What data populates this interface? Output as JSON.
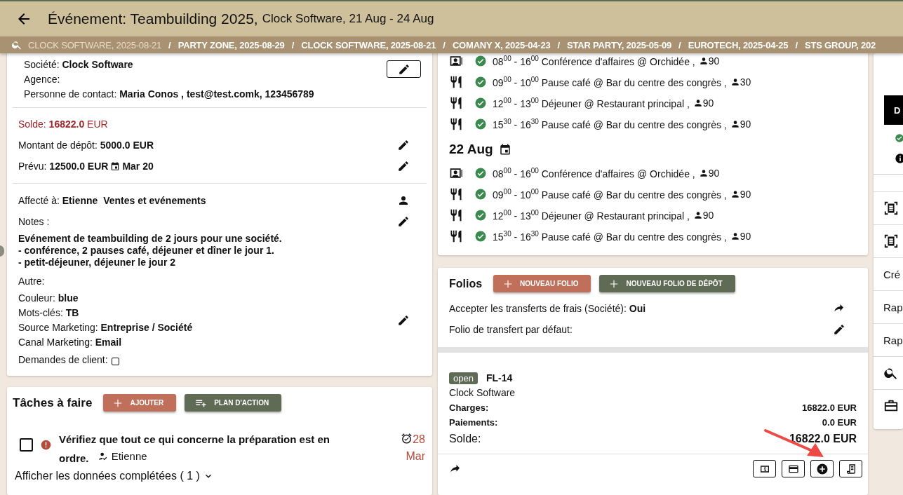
{
  "header": {
    "title": "Événement: Teambuilding 2025,",
    "subtitle": "Clock Software, 21 Aug - 24 Aug"
  },
  "breadcrumb_separator": "/",
  "breadcrumbs": [
    {
      "label": "CLOCK SOFTWARE, 2025-08-21",
      "selected": true
    },
    {
      "label": "PARTY ZONE, 2025-08-29",
      "selected": false
    },
    {
      "label": "CLOCK SOFTWARE, 2025-08-21",
      "selected": false
    },
    {
      "label": "COMANY X, 2025-04-23",
      "selected": false
    },
    {
      "label": "STAR PARTY, 2025-05-09",
      "selected": false
    },
    {
      "label": "EUROTECH, 2025-04-25",
      "selected": false
    },
    {
      "label": "STS GROUP, 202",
      "selected": false
    }
  ],
  "details": {
    "company_lines": [
      {
        "label": "Société:",
        "value": "Clock Software"
      },
      {
        "label": "Agence:"
      },
      {
        "label": "Personne de contact:",
        "value": "Maria Conos , test@test.comk, 123456789"
      }
    ],
    "balance": {
      "label": "Solde:",
      "value": "16822.0",
      "unit": "EUR"
    },
    "deposit": {
      "label": "Montant de dépôt:",
      "value": "5000.0 EUR"
    },
    "planned": {
      "label": "Prévu:",
      "value": "12500.0 EUR",
      "date": "Mar 20"
    },
    "assigned": {
      "label": "Affecté à:",
      "value": "Etienne  Ventes et evénements"
    },
    "notes": {
      "label": "Notes :",
      "lines": [
        "Evénement de teambuilding de 2 jours pour une société.",
        "- conférence, 2 pauses café, déjeuner et dîner le jour 1.",
        "- petit-déjeuner, déjeuner le jour 2"
      ]
    },
    "other_label": "Autre:",
    "other": [
      {
        "label": "Couleur:",
        "value": "blue"
      },
      {
        "label": "Mots-clés:",
        "value": "TB"
      },
      {
        "label": "Source Marketing:",
        "value": "Entreprise / Société"
      },
      {
        "label": "Canal Marketing:",
        "value": "Email"
      }
    ],
    "client_requests": {
      "label": "Demandes de client:",
      "checked": false
    }
  },
  "tasks": {
    "title": "Tâches à faire",
    "buttons": [
      {
        "label": "AJOUTER",
        "kind": "add"
      },
      {
        "label": "PLAN D'ACTION",
        "kind": "plan"
      }
    ],
    "items": [
      {
        "text": "Vérifiez que tout ce qui concerne la préparation est en ordre.",
        "assignee": "Etienne",
        "due_day": "28",
        "due_month": "Mar",
        "checked": false
      }
    ],
    "show_completed": "Afficher les données complétées ( 1 )"
  },
  "agenda": {
    "groups": [
      {
        "items": [
          {
            "kind": "meeting",
            "done": true,
            "time": "08$^{00}$ - 16$^{00}$",
            "text": "Conférence d'affaires @ Orchidée ,",
            "guests": "90"
          },
          {
            "kind": "meal",
            "done": true,
            "time": "09$^{00}$ - 10$^{00}$",
            "text": "Pause café @ Bar du centre des congrès ,",
            "guests": "30"
          },
          {
            "kind": "meal",
            "done": true,
            "time": "12$^{00}$ - 13$^{00}$",
            "text": "Déjeuner @ Restaurant principal ,",
            "guests": "90"
          },
          {
            "kind": "meal",
            "done": true,
            "time": "15$^{30}$ - 16$^{30}$",
            "text": "Pause café @ Bar du centre des congrès ,",
            "guests": "90"
          }
        ]
      },
      {
        "date": "22 Aug",
        "items": [
          {
            "kind": "meeting",
            "done": true,
            "time": "08$^{00}$ - 16$^{00}$",
            "text": "Conférence d'affaires @ Orchidée ,",
            "guests": "90"
          },
          {
            "kind": "meal",
            "done": true,
            "time": "09$^{00}$ - 10$^{00}$",
            "text": "Pause café @ Bar du centre des congrès ,",
            "guests": "90"
          },
          {
            "kind": "meal",
            "done": true,
            "time": "12$^{00}$ - 13$^{00}$",
            "text": "Déjeuner @ Restaurant principal ,",
            "guests": "90"
          },
          {
            "kind": "meal",
            "done": true,
            "time": "15$^{30}$ - 16$^{30}$",
            "text": "Pause café @ Bar du centre des congrès ,",
            "guests": "90"
          }
        ]
      }
    ]
  },
  "folios": {
    "title": "Folios",
    "buttons": [
      {
        "label": "NOUVEAU FOLIO",
        "kind": "add"
      },
      {
        "label": "NOUVEAU FOLIO DE DÉPÔT",
        "kind": "deposit"
      }
    ],
    "settings": [
      {
        "kind": "transfer",
        "label": "Accepter les transferts de frais (Société):",
        "value": "Oui"
      },
      {
        "kind": "edit",
        "label": "Folio de transfert par défaut:"
      }
    ],
    "folio": {
      "status": "open",
      "number": "FL-14",
      "company": "Clock Software",
      "rows": [
        {
          "label": "Charges:",
          "value": "16822.0 EUR"
        },
        {
          "label": "Paiements:",
          "value": "0.0 EUR"
        }
      ],
      "balance": {
        "label": "Solde:",
        "value": "16822.0 EUR"
      }
    }
  },
  "sidebar": {
    "top_button": "D",
    "items": [
      {
        "kind": "scan"
      },
      {
        "kind": "scan"
      },
      {
        "kind": "text",
        "label": "Cré"
      },
      {
        "kind": "text",
        "label": "Rap"
      },
      {
        "kind": "text",
        "label": "Rap"
      },
      {
        "kind": "search"
      },
      {
        "kind": "briefcase"
      }
    ]
  }
}
